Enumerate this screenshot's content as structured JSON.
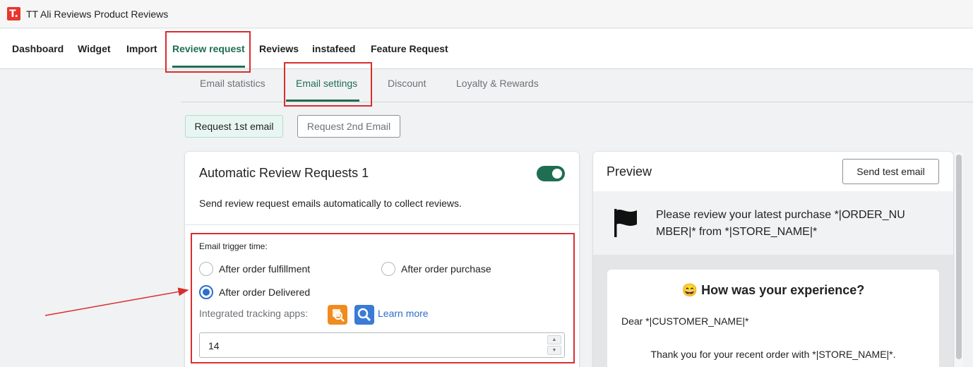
{
  "app": {
    "logo_letter": "T.",
    "title": "TT Ali Reviews Product Reviews"
  },
  "nav": {
    "items": [
      "Dashboard",
      "Widget",
      "Import",
      "Review request",
      "Reviews",
      "instafeed",
      "Feature Request"
    ],
    "active": "Review request"
  },
  "subtabs": {
    "items": [
      "Email statistics",
      "Email settings",
      "Discount",
      "Loyalty & Rewards"
    ],
    "active": "Email settings"
  },
  "request_buttons": {
    "first": "Request 1st email",
    "second": "Request 2nd Email"
  },
  "auto_card": {
    "title": "Automatic Review Requests 1",
    "enabled": true,
    "description": "Send review request emails automatically to collect reviews.",
    "trigger_label": "Email trigger time:",
    "options": [
      "After order fulfillment",
      "After order purchase",
      "After order Delivered"
    ],
    "selected_option": "After order Delivered",
    "tracking_label": "Integrated tracking apps:",
    "learn_more": "Learn more",
    "days_value": "14"
  },
  "preview": {
    "title": "Preview",
    "send_test": "Send test email",
    "subject": "Please review your latest purchase *|ORDER_NUMBER|* from *|STORE_NAME|*",
    "heading_emoji": "😄",
    "heading": "How was your experience?",
    "greeting": "Dear *|CUSTOMER_NAME|*",
    "body": "Thank you for your recent order with *|STORE_NAME|*."
  },
  "colors": {
    "accent_green": "#1f6e52",
    "annotation_red": "#d92e2e",
    "radio_blue": "#2c6ecb"
  }
}
